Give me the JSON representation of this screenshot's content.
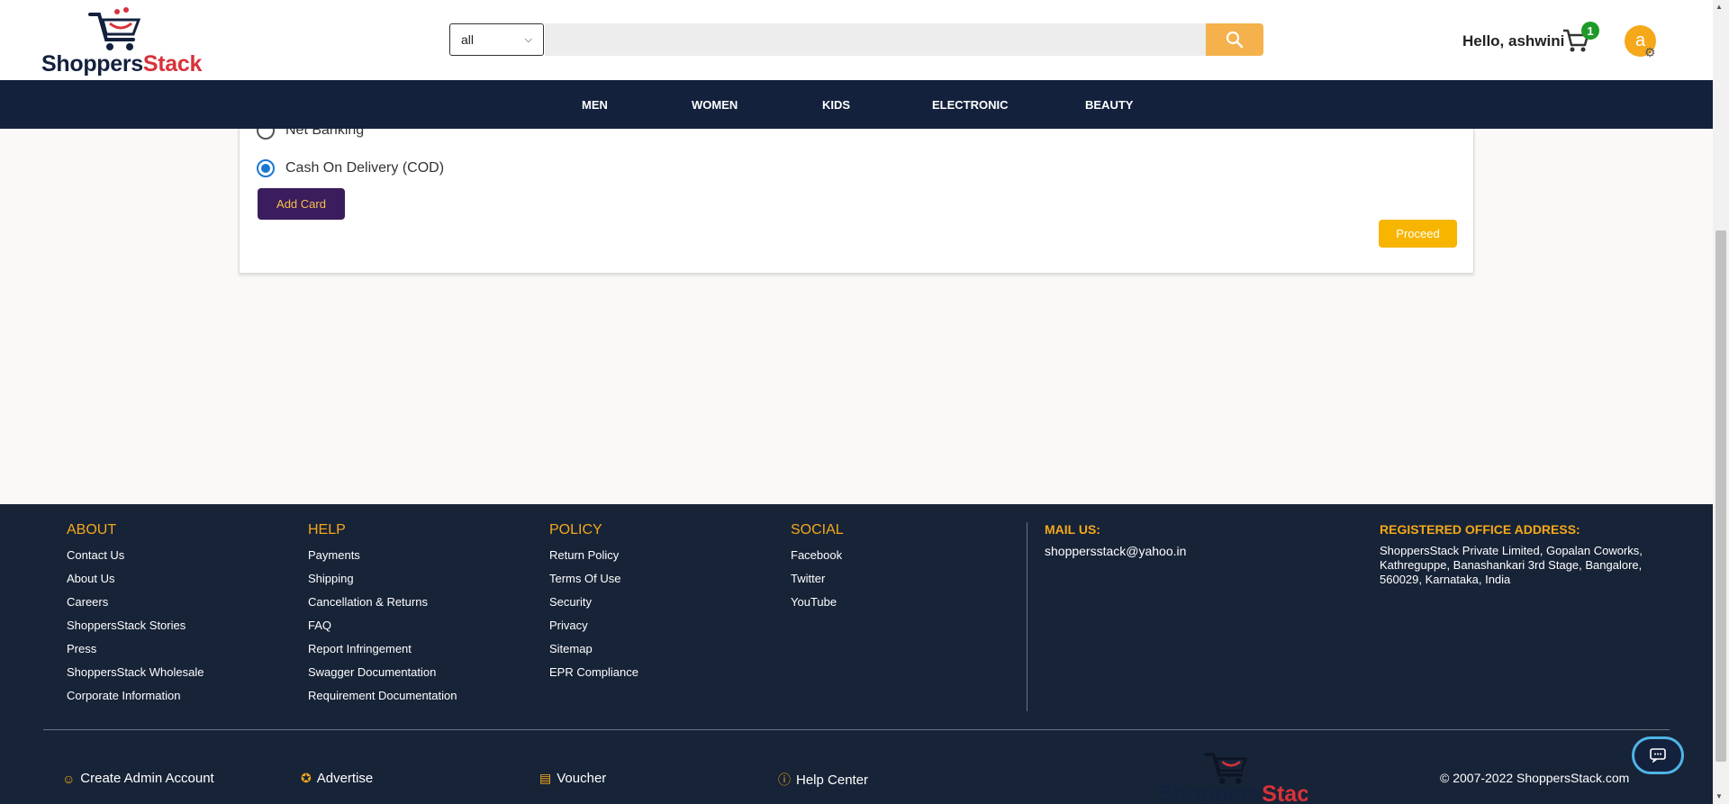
{
  "brand": {
    "part1": "Shoppers",
    "part2": "Stack",
    "color_dark": "#14213d",
    "color_red": "#d8323a"
  },
  "header": {
    "category_select": "all",
    "search_placeholder": "",
    "greeting": "Hello, ashwini",
    "cart_count": "1",
    "avatar_letter": "a"
  },
  "nav": {
    "items": [
      "MEN",
      "WOMEN",
      "KIDS",
      "ELECTRONIC",
      "BEAUTY"
    ]
  },
  "payment": {
    "options": [
      {
        "label": "Net Banking",
        "selected": false
      },
      {
        "label": "Cash On Delivery (COD)",
        "selected": true
      }
    ],
    "add_card_label": "Add Card",
    "proceed_label": "Proceed"
  },
  "footer": {
    "about": {
      "title": "ABOUT",
      "links": [
        "Contact Us",
        "About Us",
        "Careers",
        "ShoppersStack Stories",
        "Press",
        "ShoppersStack Wholesale",
        "Corporate Information"
      ]
    },
    "help": {
      "title": "HELP",
      "links": [
        "Payments",
        "Shipping",
        "Cancellation & Returns",
        "FAQ",
        "Report Infringement",
        "Swagger Documentation",
        "Requirement Documentation"
      ]
    },
    "policy": {
      "title": "POLICY",
      "links": [
        "Return Policy",
        "Terms Of Use",
        "Security",
        "Privacy",
        "Sitemap",
        "EPR Compliance"
      ]
    },
    "social": {
      "title": "SOCIAL",
      "links": [
        "Facebook",
        "Twitter",
        "YouTube"
      ]
    },
    "mail_title": "MAIL US:",
    "mail_value": "shoppersstack@yahoo.in",
    "address_title": "REGISTERED OFFICE ADDRESS:",
    "address_value": "ShoppersStack Private Limited, Gopalan Coworks, Kathreguppe, Banashankari 3rd Stage, Bangalore, 560029, Karnataka, India",
    "bottom": {
      "create_admin": "Create Admin Account",
      "advertise": "Advertise",
      "voucher": "Voucher",
      "help_center": "Help Center",
      "copyright": "© 2007-2022 ShoppersStack.com"
    }
  },
  "colors": {
    "accent": "#f5a81a",
    "footer_bg": "#172337",
    "nav_bg": "#14213d",
    "button_purple": "#3b1c5c",
    "proceed_yellow": "#f7b500"
  },
  "icons": [
    "search-icon",
    "cart-icon",
    "gear-icon",
    "user-circle-icon",
    "star-icon",
    "gift-icon",
    "help-circle-icon",
    "chat-icon"
  ]
}
